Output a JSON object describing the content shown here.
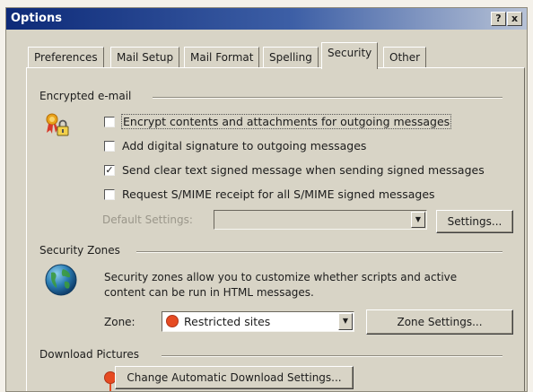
{
  "window": {
    "title": "Options",
    "help_glyph": "?",
    "close_glyph": "x"
  },
  "tabs": [
    {
      "label": "Preferences",
      "active": false
    },
    {
      "label": "Mail Setup",
      "active": false
    },
    {
      "label": "Mail Format",
      "active": false
    },
    {
      "label": "Spelling",
      "active": false
    },
    {
      "label": "Security",
      "active": true
    },
    {
      "label": "Other",
      "active": false
    }
  ],
  "encrypted_email": {
    "heading": "Encrypted e-mail",
    "icon": "certificate-lock-icon",
    "options": [
      {
        "label": "Encrypt contents and attachments for outgoing messages",
        "checked": false
      },
      {
        "label": "Add digital signature to outgoing messages",
        "checked": false
      },
      {
        "label": "Send clear text signed message when sending signed messages",
        "checked": true
      },
      {
        "label": "Request S/MIME receipt for all S/MIME signed messages",
        "checked": false
      }
    ],
    "default_settings_label": "Default Settings:",
    "default_settings_value": "",
    "settings_button": "Settings..."
  },
  "security_zones": {
    "heading": "Security Zones",
    "icon": "globe-icon",
    "description_line1": "Security zones allow you to customize whether scripts and active",
    "description_line2": "content can be run in HTML messages.",
    "zone_label": "Zone:",
    "zone_value": "Restricted sites",
    "zone_settings_button": "Zone Settings..."
  },
  "download_pictures": {
    "heading": "Download Pictures",
    "button": "Change Automatic Download Settings..."
  },
  "colors": {
    "titlebar_start": "#0d2a78",
    "dialog_bg": "#d8d4c6",
    "restricted_marker": "#e64b22"
  }
}
